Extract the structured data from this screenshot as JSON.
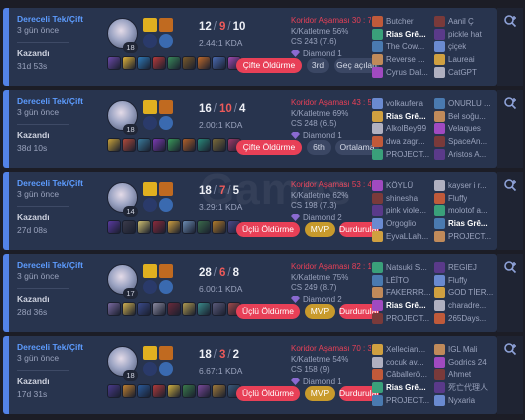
{
  "colors": {
    "win_accent": "#5383e8",
    "card_bg": "#28344e",
    "loss_red": "#e84057",
    "mvp_gold": "#c89a2c"
  },
  "icons": [
    "champion-portrait-icon",
    "summoner-spell-icon",
    "rune-icon",
    "item-icon",
    "diamond-rank-icon",
    "player-champion-icon",
    "expand-chevron-icon"
  ],
  "watermark": "Games",
  "matches": [
    {
      "mode": "Dereceli Tek/Çift",
      "ago": "3 gün önce",
      "result": "Kazandı",
      "duration": "31d 53s",
      "level": "18",
      "kills": "12",
      "deaths": "9",
      "assists": "10",
      "kda_ratio": "2.44:1 KDA",
      "kill_participation": "Koridor Aşaması 30 : 70",
      "kp": "K/Katletme 56%",
      "cs": "CS 243 (7.6)",
      "rank": "Diamond 1",
      "tags": [
        "Çifte Öldürme",
        "3rd",
        "Geç açılan"
      ],
      "team1": [
        "Butcher",
        "Rias Grê...",
        "The Cow...",
        "Reverse ...",
        "Cyrus Dal..."
      ],
      "team2": [
        "Aanil Ç",
        "pickle hat",
        "çiçek",
        "Laureai",
        "CatGPT"
      ]
    },
    {
      "mode": "Dereceli Tek/Çift",
      "ago": "3 gün önce",
      "result": "Kazandı",
      "duration": "38d 10s",
      "level": "18",
      "kills": "16",
      "deaths": "10",
      "assists": "4",
      "kda_ratio": "2.00:1 KDA",
      "kill_participation": "Koridor Aşaması 43 : 57",
      "kp": "K/Katletme 69%",
      "cs": "CS 248 (6.5)",
      "rank": "Diamond 1",
      "tags": [
        "Çifte Öldürme",
        "6th",
        "Ortalama"
      ],
      "team1": [
        "volkaufera",
        "Rias Grê...",
        "AlkolBey99",
        "dwa zagr...",
        "PROJECT..."
      ],
      "team2": [
        "ONURLU ...",
        "Bel soğu...",
        "Velaques",
        "SpaceAn...",
        "Aristos A..."
      ]
    },
    {
      "mode": "Dereceli Tek/Çift",
      "ago": "3 gün önce",
      "result": "Kazandı",
      "duration": "27d 08s",
      "level": "14",
      "kills": "18",
      "deaths": "7",
      "assists": "5",
      "kda_ratio": "3.29:1 KDA",
      "kill_participation": "Koridor Aşaması 53 : 47",
      "kp": "K/Katletme 62%",
      "cs": "CS 198 (7.3)",
      "rank": "Diamond 2",
      "tags": [
        "Üçlü Öldürme",
        "MVP",
        "Durdurulamaz"
      ],
      "team1": [
        "KÖYLÜ",
        "shinesha",
        "pink viole...",
        "Orgoglio",
        "EyvaLLah..."
      ],
      "team2": [
        "kayser i r...",
        "Fluffy",
        "molotof a...",
        "Rias Grê...",
        "PROJECT..."
      ]
    },
    {
      "mode": "Dereceli Tek/Çift",
      "ago": "3 gün önce",
      "result": "Kazandı",
      "duration": "28d 36s",
      "level": "17",
      "kills": "28",
      "deaths": "6",
      "assists": "8",
      "kda_ratio": "6.00:1 KDA",
      "kill_participation": "Koridor Aşaması 82 : 18",
      "kp": "K/Katletme 75%",
      "cs": "CS 249 (8.7)",
      "rank": "Diamond 2",
      "tags": [
        "Üçlü Öldürme",
        "MVP",
        "Durdurulamaz"
      ],
      "team1": [
        "Natsuki S...",
        "LÉÎTO",
        "FAKERRR...",
        "Rias Grê...",
        "PROJECT..."
      ],
      "team2": [
        "REGIEJ",
        "Fluffy",
        "GOD TİER...",
        "charadre...",
        "265Days..."
      ]
    },
    {
      "mode": "Dereceli Tek/Çift",
      "ago": "3 gün önce",
      "result": "Kazandı",
      "duration": "17d 31s",
      "level": "18",
      "kills": "18",
      "deaths": "3",
      "assists": "2",
      "kda_ratio": "6.67:1 KDA",
      "kill_participation": "Koridor Aşaması 70 : 30",
      "kp": "K/Katletme 54%",
      "cs": "CS 158 (9)",
      "rank": "Diamond 1",
      "tags": [
        "Üçlü Öldürme",
        "MVP",
        "Durdurulamaz"
      ],
      "team1": [
        "Xellecian...",
        "cocuk av...",
        "Câballerö...",
        "Rias Grê...",
        "PROJECT..."
      ],
      "team2": [
        "IGL Mali",
        "Godrics 24",
        "Ahmet",
        "死亡代理人",
        "Nyxaria"
      ]
    }
  ]
}
